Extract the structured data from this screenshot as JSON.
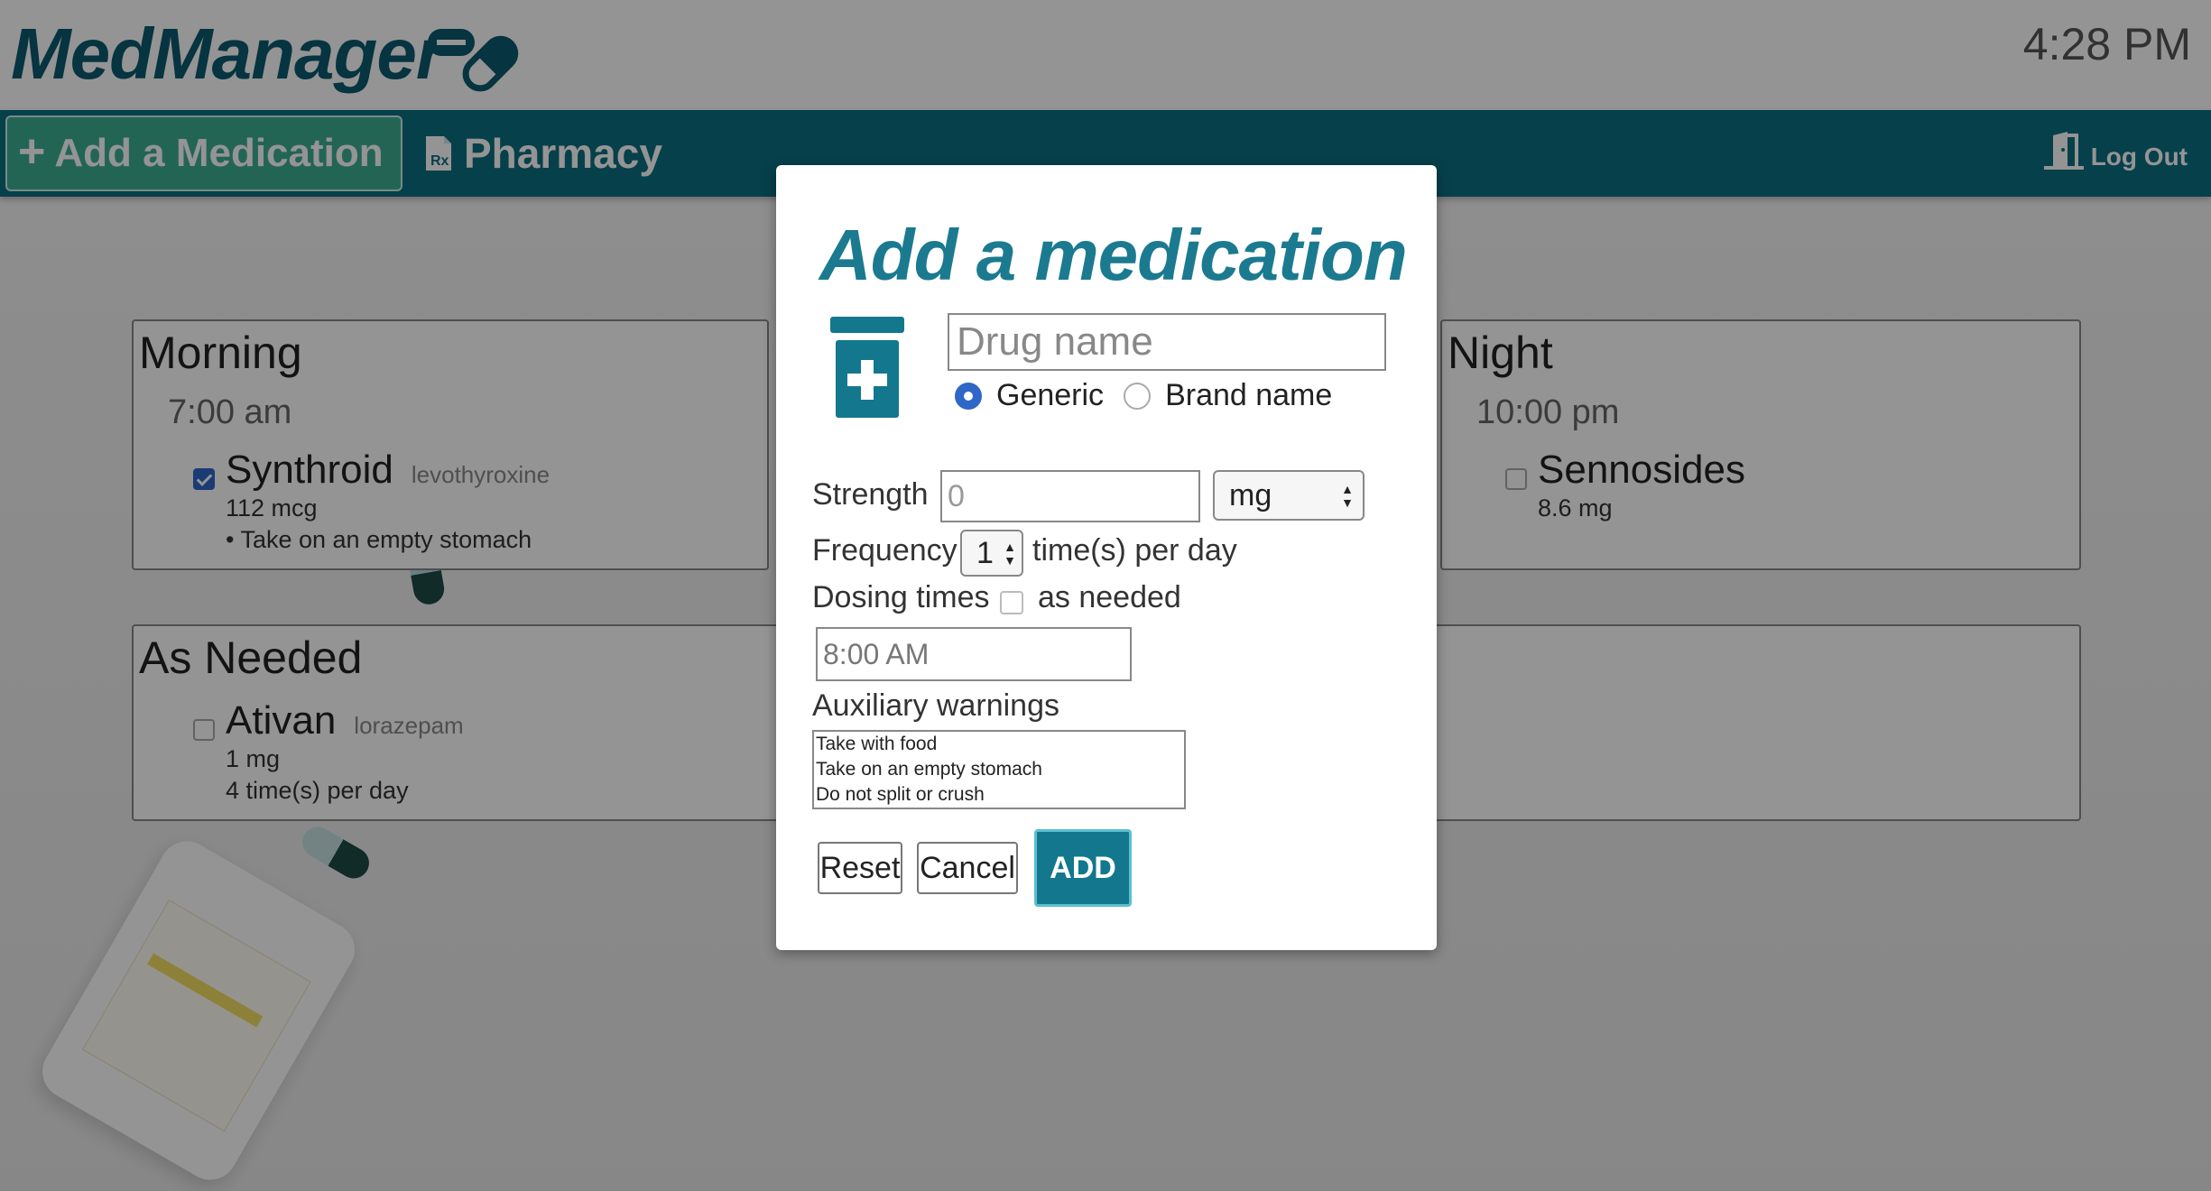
{
  "app": {
    "logo": "MedManager",
    "clock": "4:28 PM"
  },
  "nav": {
    "add_label": "Add a Medication",
    "pharmacy_label": "Pharmacy",
    "logout_label": "Log Out"
  },
  "schedule": {
    "morning": {
      "title": "Morning",
      "time": "7:00 am",
      "meds": [
        {
          "name": "Synthroid",
          "generic": "levothyroxine",
          "dose": "112 mcg",
          "note": "• Take on an empty stomach",
          "checked": true
        }
      ]
    },
    "night": {
      "title": "Night",
      "time": "10:00 pm",
      "meds": [
        {
          "name": "Sennosides",
          "dose": "8.6 mg",
          "checked": false
        }
      ]
    },
    "as_needed": {
      "title": "As Needed",
      "meds": [
        {
          "name": "Ativan",
          "generic": "lorazepam",
          "dose": "1 mg",
          "frequency": "4 time(s) per day",
          "checked": false
        }
      ]
    }
  },
  "modal": {
    "title": "Add a medication",
    "drug_placeholder": "Drug name",
    "name_type": {
      "generic_label": "Generic",
      "brand_label": "Brand name",
      "selected": "Generic"
    },
    "strength_label": "Strength",
    "strength_placeholder": "0",
    "unit_selected": "mg",
    "frequency_label": "Frequency",
    "frequency_value": "1",
    "frequency_suffix": "time(s) per day",
    "dosing_label": "Dosing times",
    "as_needed_label": "as needed",
    "dose_time_placeholder": "8:00 AM",
    "warnings_label": "Auxiliary warnings",
    "warnings_options": [
      "Take with food",
      "Take on an empty stomach",
      "Do not split or crush"
    ],
    "reset_label": "Reset",
    "cancel_label": "Cancel",
    "add_label": "ADD"
  },
  "colors": {
    "brand": "#0b5a6e",
    "navbar": "#0c6e82",
    "add_nav_button": "#3daf93",
    "primary_button": "#13788d",
    "radio_checked": "#2e67c7"
  },
  "icons": [
    "pill-logo-icon",
    "plus-icon",
    "prescription-file-icon",
    "door-exit-icon",
    "medicine-bottle-icon"
  ]
}
